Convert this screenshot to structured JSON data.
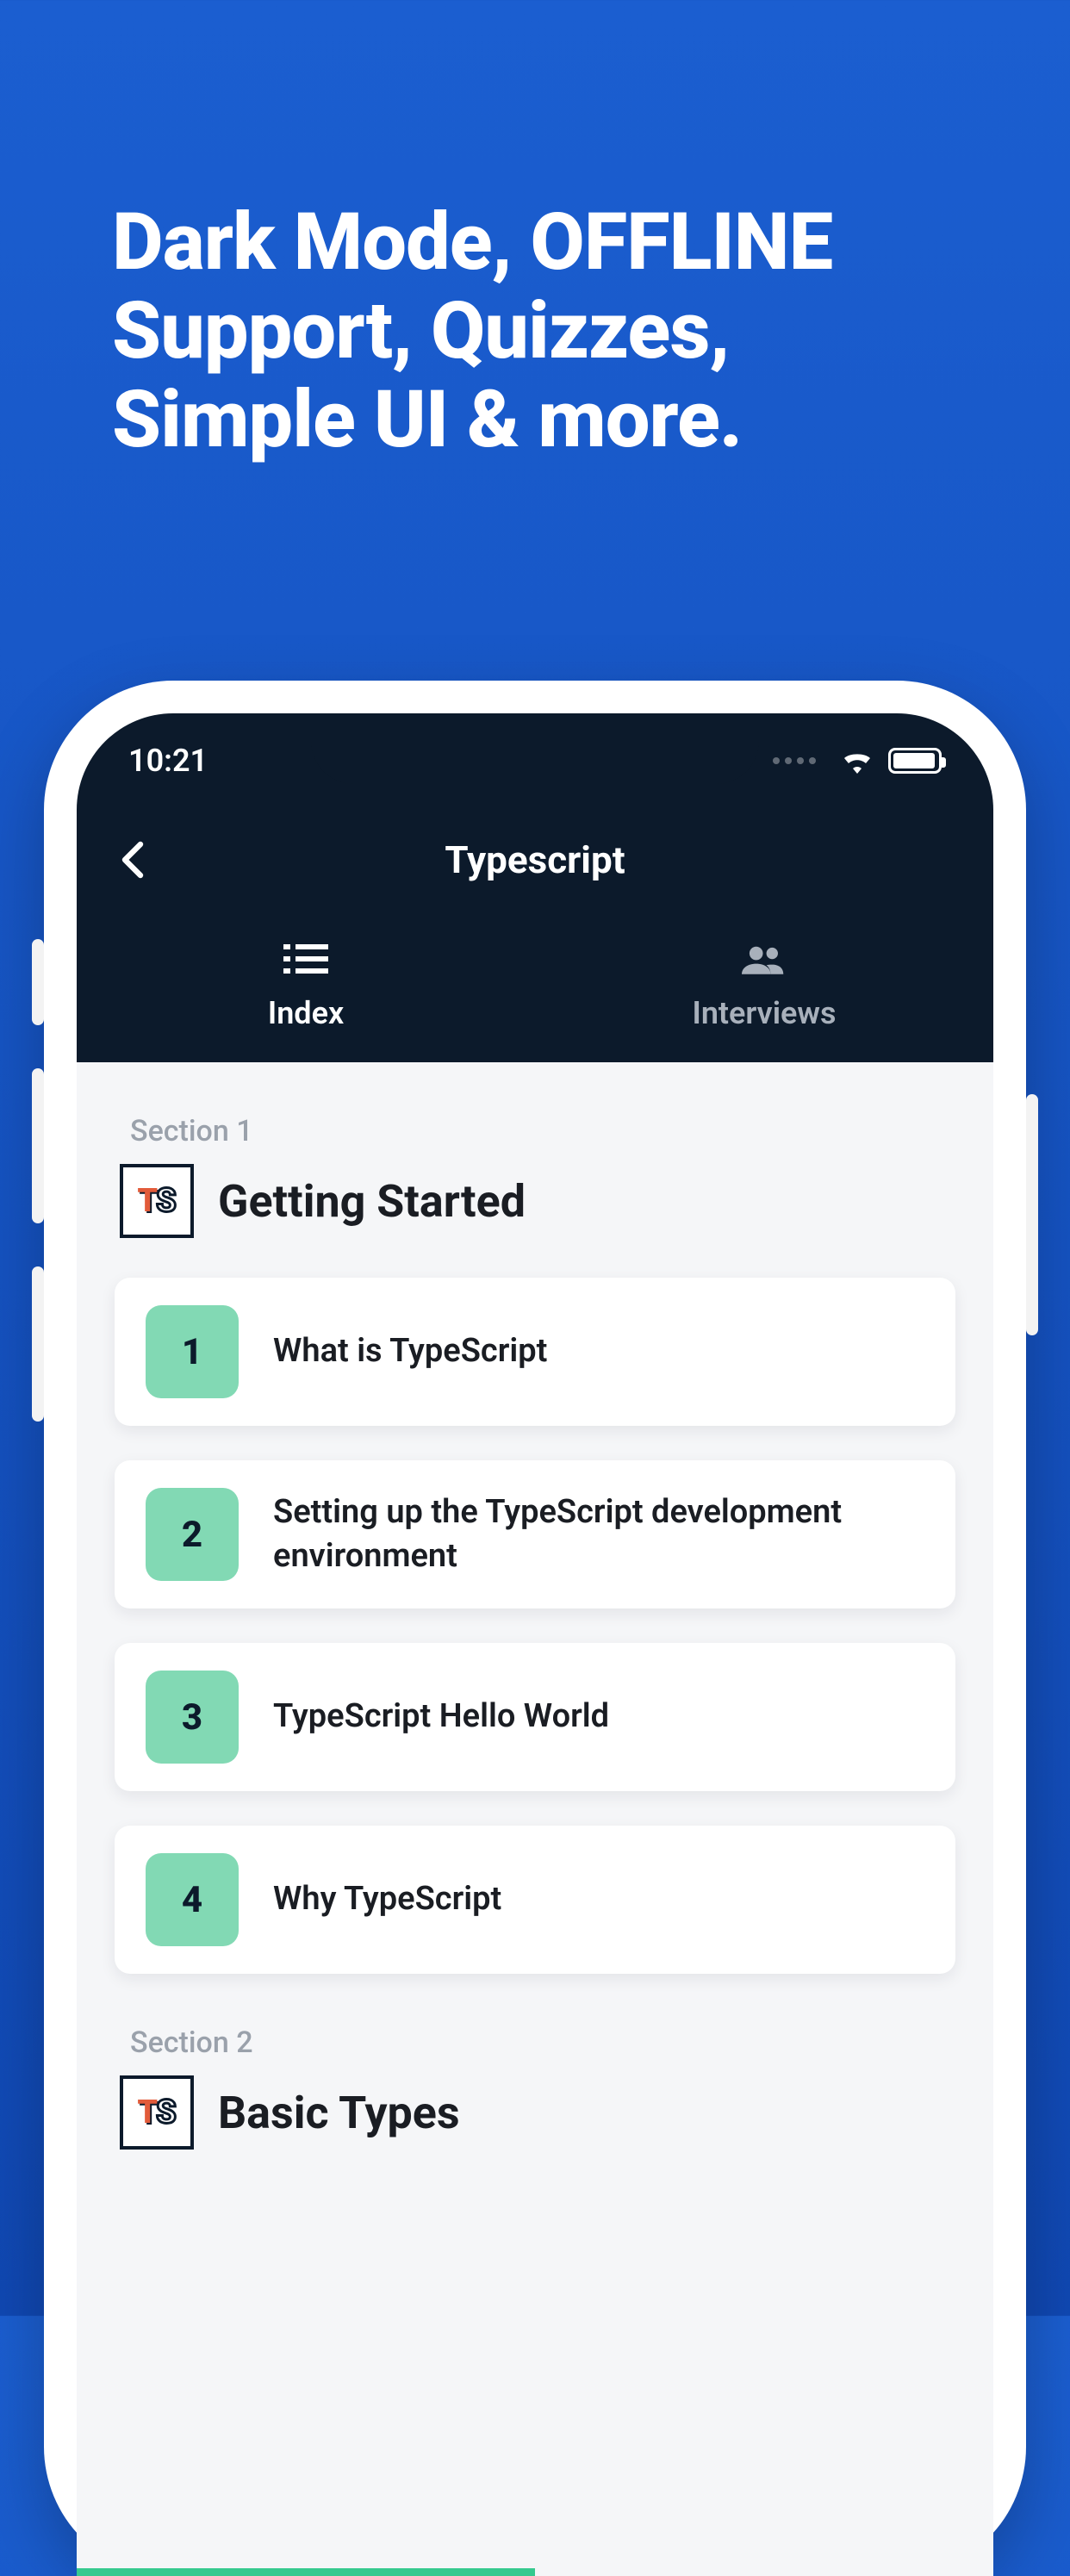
{
  "marketing": {
    "headline": "Dark Mode, OFFLINE Support, Quizzes, Simple UI & more."
  },
  "statusbar": {
    "time": "10:21"
  },
  "navbar": {
    "title": "Typescript"
  },
  "tabs": {
    "index": {
      "label": "Index"
    },
    "interviews": {
      "label": "Interviews"
    }
  },
  "sections": [
    {
      "label": "Section 1",
      "title": "Getting Started",
      "items": [
        {
          "num": "1",
          "title": "What is TypeScript"
        },
        {
          "num": "2",
          "title": "Setting up the TypeScript development environment"
        },
        {
          "num": "3",
          "title": "TypeScript Hello World"
        },
        {
          "num": "4",
          "title": "Why TypeScript"
        }
      ]
    },
    {
      "label": "Section 2",
      "title": "Basic Types",
      "items": []
    }
  ],
  "ts_badge": {
    "t": "T",
    "s": "S"
  }
}
